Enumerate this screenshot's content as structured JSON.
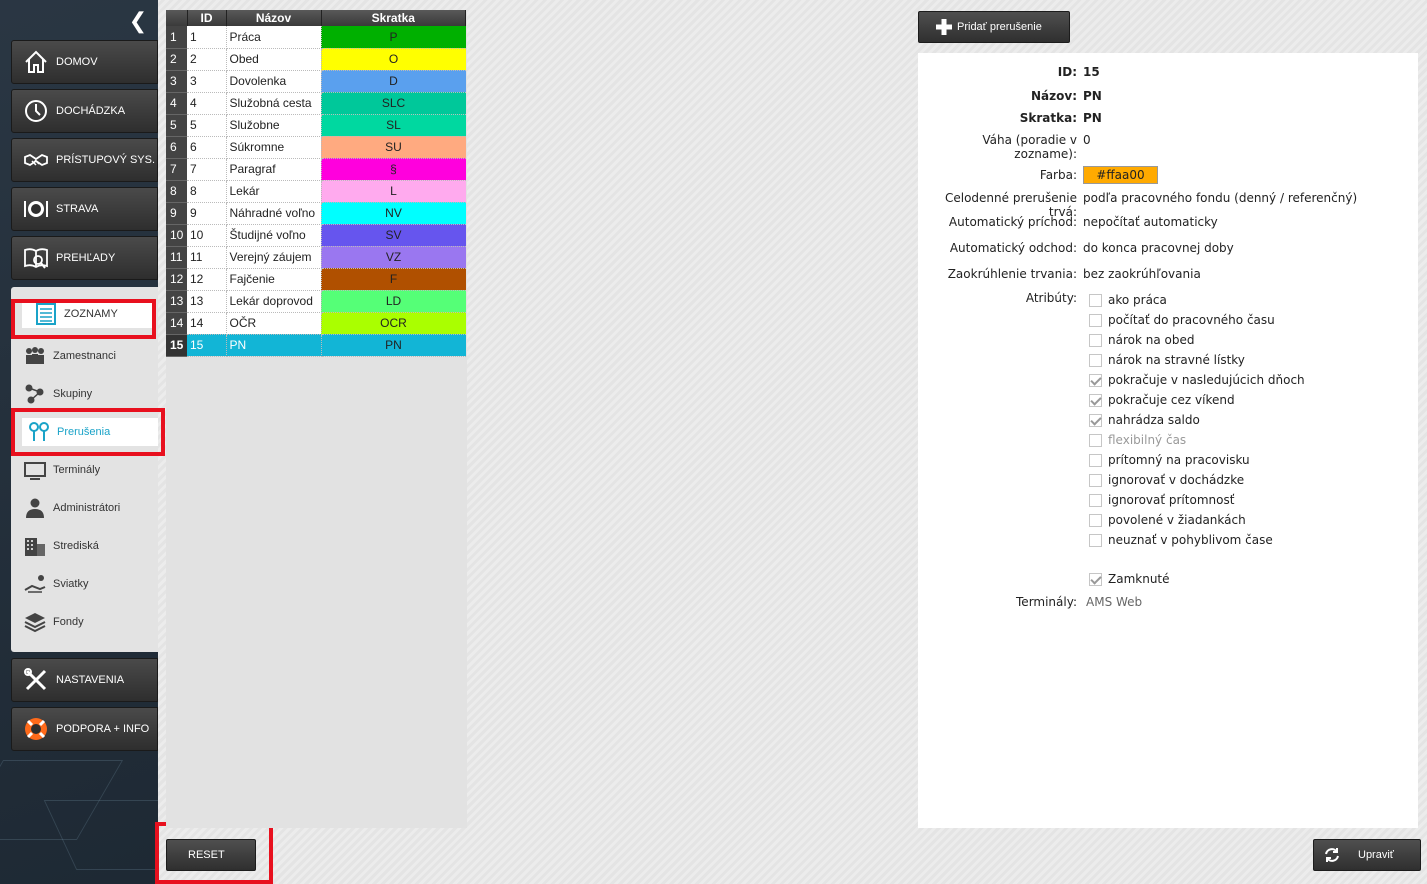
{
  "sidebar": {
    "nav_top": [
      {
        "label": "DOMOV",
        "icon": "home-icon"
      },
      {
        "label": "DOCHÁDZKA",
        "icon": "clock-icon"
      },
      {
        "label": "PRÍSTUPOVÝ SYS.",
        "icon": "handshake-icon"
      },
      {
        "label": "STRAVA",
        "icon": "plate-icon"
      },
      {
        "label": "PREHĽADY",
        "icon": "book-search-icon"
      }
    ],
    "section": {
      "label": "ZOZNAMY",
      "icon": "list-icon"
    },
    "sub_items": [
      {
        "label": "Zamestnanci",
        "icon": "people-icon"
      },
      {
        "label": "Skupiny",
        "icon": "groups-icon"
      },
      {
        "label": "Prerušenia",
        "icon": "pins-icon",
        "active": true
      },
      {
        "label": "Terminály",
        "icon": "monitor-icon"
      },
      {
        "label": "Administrátori",
        "icon": "admin-icon"
      },
      {
        "label": "Strediská",
        "icon": "building-icon"
      },
      {
        "label": "Sviatky",
        "icon": "sunbed-icon"
      },
      {
        "label": "Fondy",
        "icon": "layers-icon"
      }
    ],
    "nav_bottom": [
      {
        "label": "NASTAVENIA",
        "icon": "tools-icon"
      },
      {
        "label": "PODPORA + INFO",
        "icon": "lifebuoy-icon"
      }
    ]
  },
  "table": {
    "headers": [
      "ID",
      "Názov",
      "Skratka"
    ],
    "rows": [
      {
        "n": "1",
        "id": "1",
        "name": "Práca",
        "abbr": "P",
        "color": "#00b000"
      },
      {
        "n": "2",
        "id": "2",
        "name": "Obed",
        "abbr": "O",
        "color": "#ffff00"
      },
      {
        "n": "3",
        "id": "3",
        "name": "Dovolenka",
        "abbr": "D",
        "color": "#5aa0ee"
      },
      {
        "n": "4",
        "id": "4",
        "name": "Služobná cesta",
        "abbr": "SLC",
        "color": "#00c89a"
      },
      {
        "n": "5",
        "id": "5",
        "name": "Služobne",
        "abbr": "SL",
        "color": "#00d8a0"
      },
      {
        "n": "6",
        "id": "6",
        "name": "Súkromne",
        "abbr": "SU",
        "color": "#ffaa80"
      },
      {
        "n": "7",
        "id": "7",
        "name": "Paragraf",
        "abbr": "§",
        "color": "#ff00dd"
      },
      {
        "n": "8",
        "id": "8",
        "name": "Lekár",
        "abbr": "L",
        "color": "#ffaaee"
      },
      {
        "n": "9",
        "id": "9",
        "name": "Náhradné voľno",
        "abbr": "NV",
        "color": "#00ffff"
      },
      {
        "n": "10",
        "id": "10",
        "name": "Študijné voľno",
        "abbr": "SV",
        "color": "#6655ee"
      },
      {
        "n": "11",
        "id": "11",
        "name": "Verejný záujem",
        "abbr": "VZ",
        "color": "#9a77f0"
      },
      {
        "n": "12",
        "id": "12",
        "name": "Fajčenie",
        "abbr": "F",
        "color": "#b05000"
      },
      {
        "n": "13",
        "id": "13",
        "name": "Lekár doprovod",
        "abbr": "LD",
        "color": "#55ff77"
      },
      {
        "n": "14",
        "id": "14",
        "name": "OČR",
        "abbr": "OCR",
        "color": "#aaff00"
      },
      {
        "n": "15",
        "id": "15",
        "name": "PN",
        "abbr": "PN",
        "color": "#12b5d6",
        "selected": true
      }
    ]
  },
  "toolbar": {
    "add_label": "Pridať prerušenie",
    "reset_label": "RESET",
    "edit_label": "Upraviť"
  },
  "detail": {
    "id_label": "ID:",
    "id_value": "15",
    "name_label": "Názov:",
    "name_value": "PN",
    "abbr_label": "Skratka:",
    "abbr_value": "PN",
    "weight_label": "Váha (poradie v zozname):",
    "weight_value": "0",
    "color_label": "Farba:",
    "color_value": "#ffaa00",
    "fullday_label": "Celodenné prerušenie trvá:",
    "fullday_value": "podľa pracovného fondu (denný / referenčný)",
    "auto_in_label": "Automatický príchod:",
    "auto_in_value": "nepočítať automaticky",
    "auto_out_label": "Automatický odchod:",
    "auto_out_value": "do konca pracovnej doby",
    "rounding_label": "Zaokrúhlenie trvania:",
    "rounding_value": "bez zaokrúhľovania",
    "attributes_label": "Atribúty:",
    "attributes": [
      {
        "label": "ako práca",
        "checked": false,
        "disabled": false
      },
      {
        "label": "počítať do pracovného času",
        "checked": false,
        "disabled": false
      },
      {
        "label": "nárok na obed",
        "checked": false,
        "disabled": false
      },
      {
        "label": "nárok na stravné lístky",
        "checked": false,
        "disabled": false
      },
      {
        "label": "pokračuje v nasledujúcich dňoch",
        "checked": true,
        "disabled": false
      },
      {
        "label": "pokračuje cez víkend",
        "checked": true,
        "disabled": false
      },
      {
        "label": "nahrádza saldo",
        "checked": true,
        "disabled": false
      },
      {
        "label": "flexibilný čas",
        "checked": false,
        "disabled": true
      },
      {
        "label": "prítomný na pracovisku",
        "checked": false,
        "disabled": false
      },
      {
        "label": "ignorovať v dochádzke",
        "checked": false,
        "disabled": false
      },
      {
        "label": "ignorovať prítomnosť",
        "checked": false,
        "disabled": false
      },
      {
        "label": "povolené v žiadankách",
        "checked": false,
        "disabled": false
      },
      {
        "label": "neuznať v pohyblivom čase",
        "checked": false,
        "disabled": false
      }
    ],
    "locked_label": "Zamknuté",
    "locked_checked": true,
    "terminals_label": "Terminály:",
    "terminals_value": "AMS Web"
  }
}
